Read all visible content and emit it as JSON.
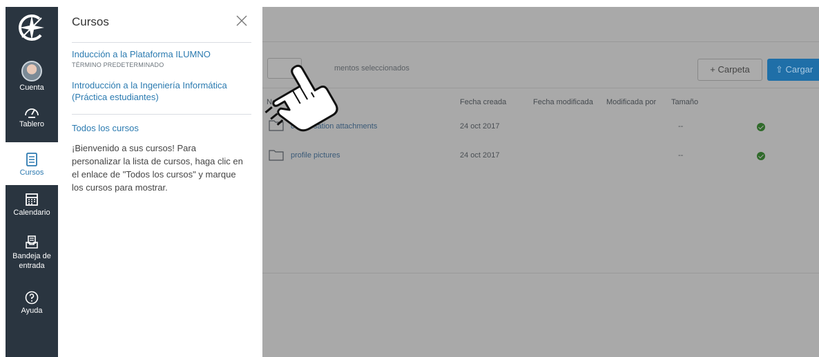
{
  "nav": {
    "items": [
      {
        "label": "Cuenta",
        "icon": "avatar"
      },
      {
        "label": "Tablero",
        "icon": "dashboard-icon"
      },
      {
        "label": "Cursos",
        "icon": "book-icon"
      },
      {
        "label": "Calendario",
        "icon": "calendar-icon"
      },
      {
        "label": "Bandeja de\nentrada",
        "line1": "Bandeja de",
        "line2": "entrada",
        "icon": "inbox-icon"
      },
      {
        "label": "Ayuda",
        "icon": "help-icon"
      }
    ]
  },
  "tray": {
    "title": "Cursos",
    "courses": [
      {
        "name": "Inducción a la Plataforma ILUMNO",
        "term": "TÉRMINO PREDETERMINADO"
      },
      {
        "name_line1": "Introducción a la Ingeniería Informática",
        "name_line2": "(Práctica estudiantes)"
      }
    ],
    "all_courses_link": "Todos los cursos",
    "welcome_text": "¡Bienvenido a sus cursos! Para personalizar la lista de cursos, haga clic en el enlace de \"Todos los cursos\" y marque los cursos para mostrar."
  },
  "files": {
    "selected_text": "mentos seleccionados",
    "new_folder_label": "+ Carpeta",
    "upload_label": "⇧ Cargar",
    "columns": [
      "No",
      "Fecha creada",
      "Fecha modificada",
      "Modificada por",
      "Tamaño"
    ],
    "rows": [
      {
        "name": "conversation attachments",
        "created": "24 oct 2017",
        "size": "--"
      },
      {
        "name": "profile pictures",
        "created": "24 oct 2017",
        "size": "--"
      }
    ]
  },
  "colors": {
    "nav_bg": "#2a3540",
    "link": "#2a7ab0",
    "overlay": "#a9a9a9",
    "upload_button": "#1f6fa8"
  }
}
